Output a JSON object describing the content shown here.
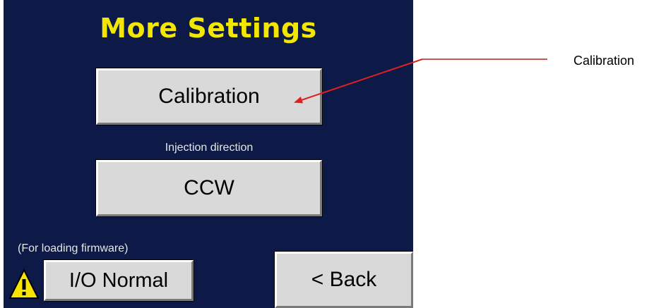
{
  "panel": {
    "title": "More Settings"
  },
  "buttons": {
    "calibration_label": "Calibration",
    "direction_caption": "Injection direction",
    "direction_value": "CCW",
    "firmware_caption": "(For loading firmware)",
    "io_label": "I/O Normal",
    "back_label": "< Back"
  },
  "annotation": {
    "label": "Calibration"
  },
  "icons": {
    "warning": "warning-triangle-icon"
  },
  "colors": {
    "panel_background": "#0d1a47",
    "title": "#f3e600",
    "button_face": "#d9d9d9",
    "annotation_arrow": "#e02020"
  }
}
